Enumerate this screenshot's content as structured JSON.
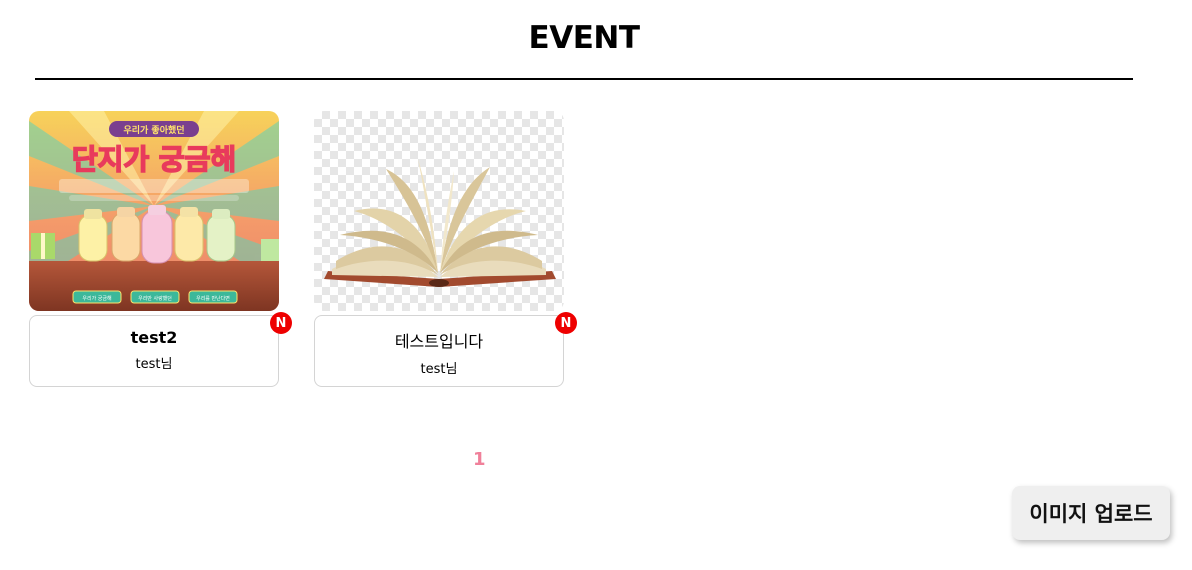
{
  "header": {
    "title": "EVENT"
  },
  "events": [
    {
      "title": "test2",
      "author": "test님",
      "badge": "N",
      "thumbnail": {
        "kind": "event-banner",
        "heading_small": "우리가 좋아했던",
        "heading_large": "단지가 궁금해",
        "buttons": [
          "우리가 궁금해",
          "우리만 사랑했던",
          "우리를 만난다면"
        ]
      }
    },
    {
      "title": "테스트입니다",
      "author": "test님",
      "badge": "N",
      "thumbnail": {
        "kind": "open-book"
      }
    }
  ],
  "pagination": {
    "current": "1"
  },
  "actions": {
    "upload_label": "이미지 업로드"
  },
  "colors": {
    "badge": "#ee0000",
    "page_active": "#f0809a",
    "rule": "#000000"
  }
}
